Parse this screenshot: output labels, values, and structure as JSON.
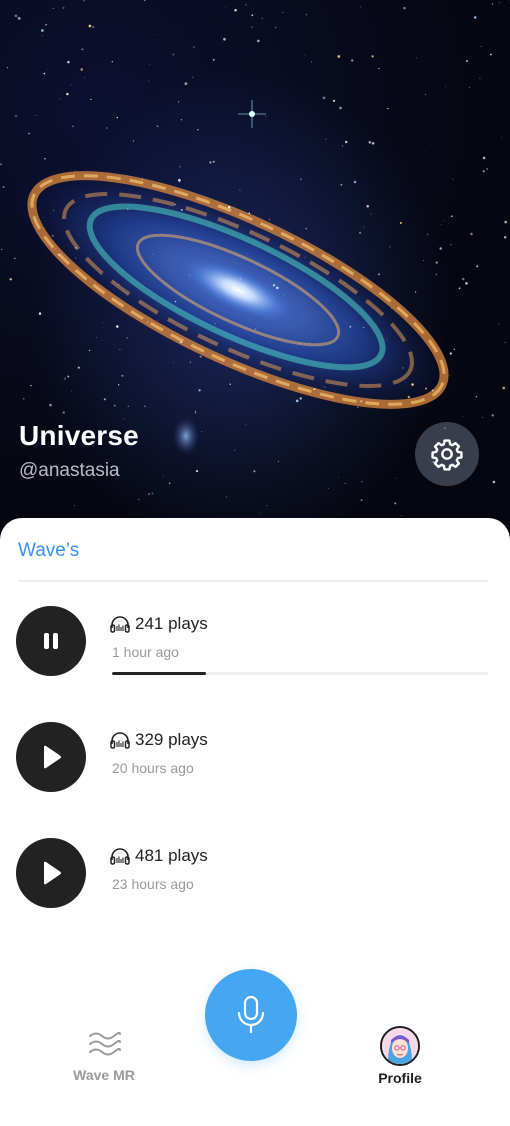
{
  "profile": {
    "name": "Universe",
    "handle": "@anastasia"
  },
  "section": {
    "title": "Wave’s"
  },
  "tracks": [
    {
      "plays": "241 plays",
      "time_ago": "1 hour ago",
      "state": "playing",
      "progress": 0.25
    },
    {
      "plays": "329 plays",
      "time_ago": "20 hours ago",
      "state": "paused"
    },
    {
      "plays": "481 plays",
      "time_ago": "23 hours ago",
      "state": "paused"
    }
  ],
  "nav": {
    "wave_label": "Wave MR",
    "profile_label": "Profile"
  },
  "icons": {
    "settings": "gear-icon",
    "pause": "pause-icon",
    "play": "play-icon",
    "plays": "headphones-icon",
    "mic": "microphone-icon",
    "wave": "wave-icon"
  },
  "colors": {
    "accent": "#3d8ff2",
    "mic_button": "#45a7f1",
    "play_button": "#222222"
  }
}
